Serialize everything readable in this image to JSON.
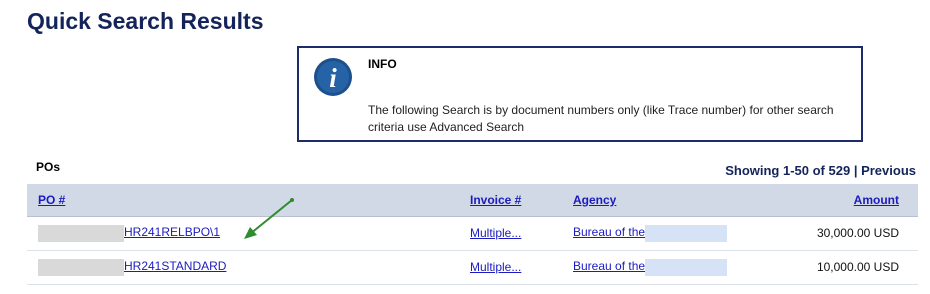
{
  "page": {
    "title": "Quick Search Results"
  },
  "info": {
    "heading": "INFO",
    "text": "The following Search is by document numbers only (like Trace number) for other search criteria use Advanced Search",
    "icon": "info-icon"
  },
  "results": {
    "section_label": "POs",
    "pager_showing": "Showing 1-50 of 529",
    "pager_separator": " | ",
    "pager_previous": "Previous",
    "columns": {
      "po": "PO #",
      "invoice": "Invoice #",
      "agency": "Agency",
      "amount": "Amount"
    },
    "rows": [
      {
        "po_suffix": "HR241RELBPO\\1",
        "invoice": "Multiple...",
        "agency": "Bureau of the",
        "amount": "30,000.00 USD"
      },
      {
        "po_suffix": "HR241STANDARD",
        "invoice": "Multiple...",
        "agency": "Bureau of the",
        "amount": "10,000.00 USD"
      }
    ]
  },
  "colors": {
    "title": "#14245a",
    "link": "#1b1bbf",
    "header_bg": "#d2d9e6",
    "arrow": "#2e8b2e"
  }
}
